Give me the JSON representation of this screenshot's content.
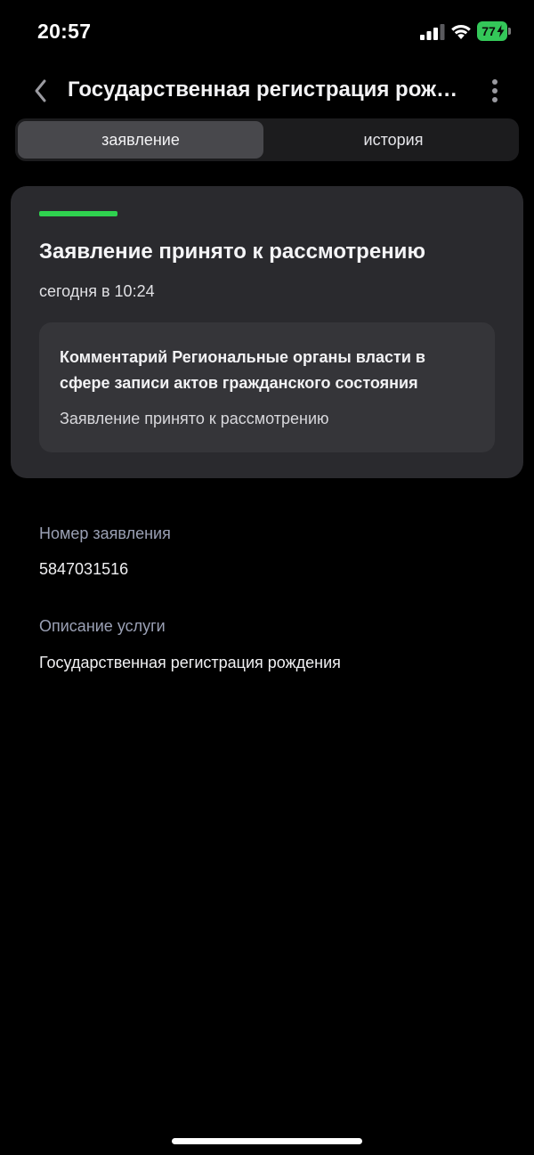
{
  "status_bar": {
    "time": "20:57",
    "battery_level": "77",
    "icons": [
      "signal-icon",
      "wifi-icon",
      "battery-icon",
      "charging-bolt-icon"
    ]
  },
  "header": {
    "back_icon": "chevron-left-icon",
    "title": "Государственная регистрация рождения",
    "more_icon": "vertical-dots-icon"
  },
  "tabs": [
    {
      "label": "заявление",
      "active": true
    },
    {
      "label": "история",
      "active": false
    }
  ],
  "status_card": {
    "accent_color": "#2fd24f",
    "title": "Заявление принято к рассмотрению",
    "time": "сегодня в 10:24",
    "comment": {
      "title": "Комментарий Региональные органы власти в сфере записи актов гражданского состояния",
      "text": "Заявление принято к рассмотрению"
    }
  },
  "details": {
    "number_label": "Номер заявления",
    "number_value": "5847031516",
    "description_label": "Описание услуги",
    "description_value": "Государственная регистрация рождения"
  },
  "colors": {
    "background": "#000000",
    "card": "#2a2a2e",
    "comment_box": "#353539",
    "label": "#9aa0b4",
    "battery": "#34c759"
  }
}
